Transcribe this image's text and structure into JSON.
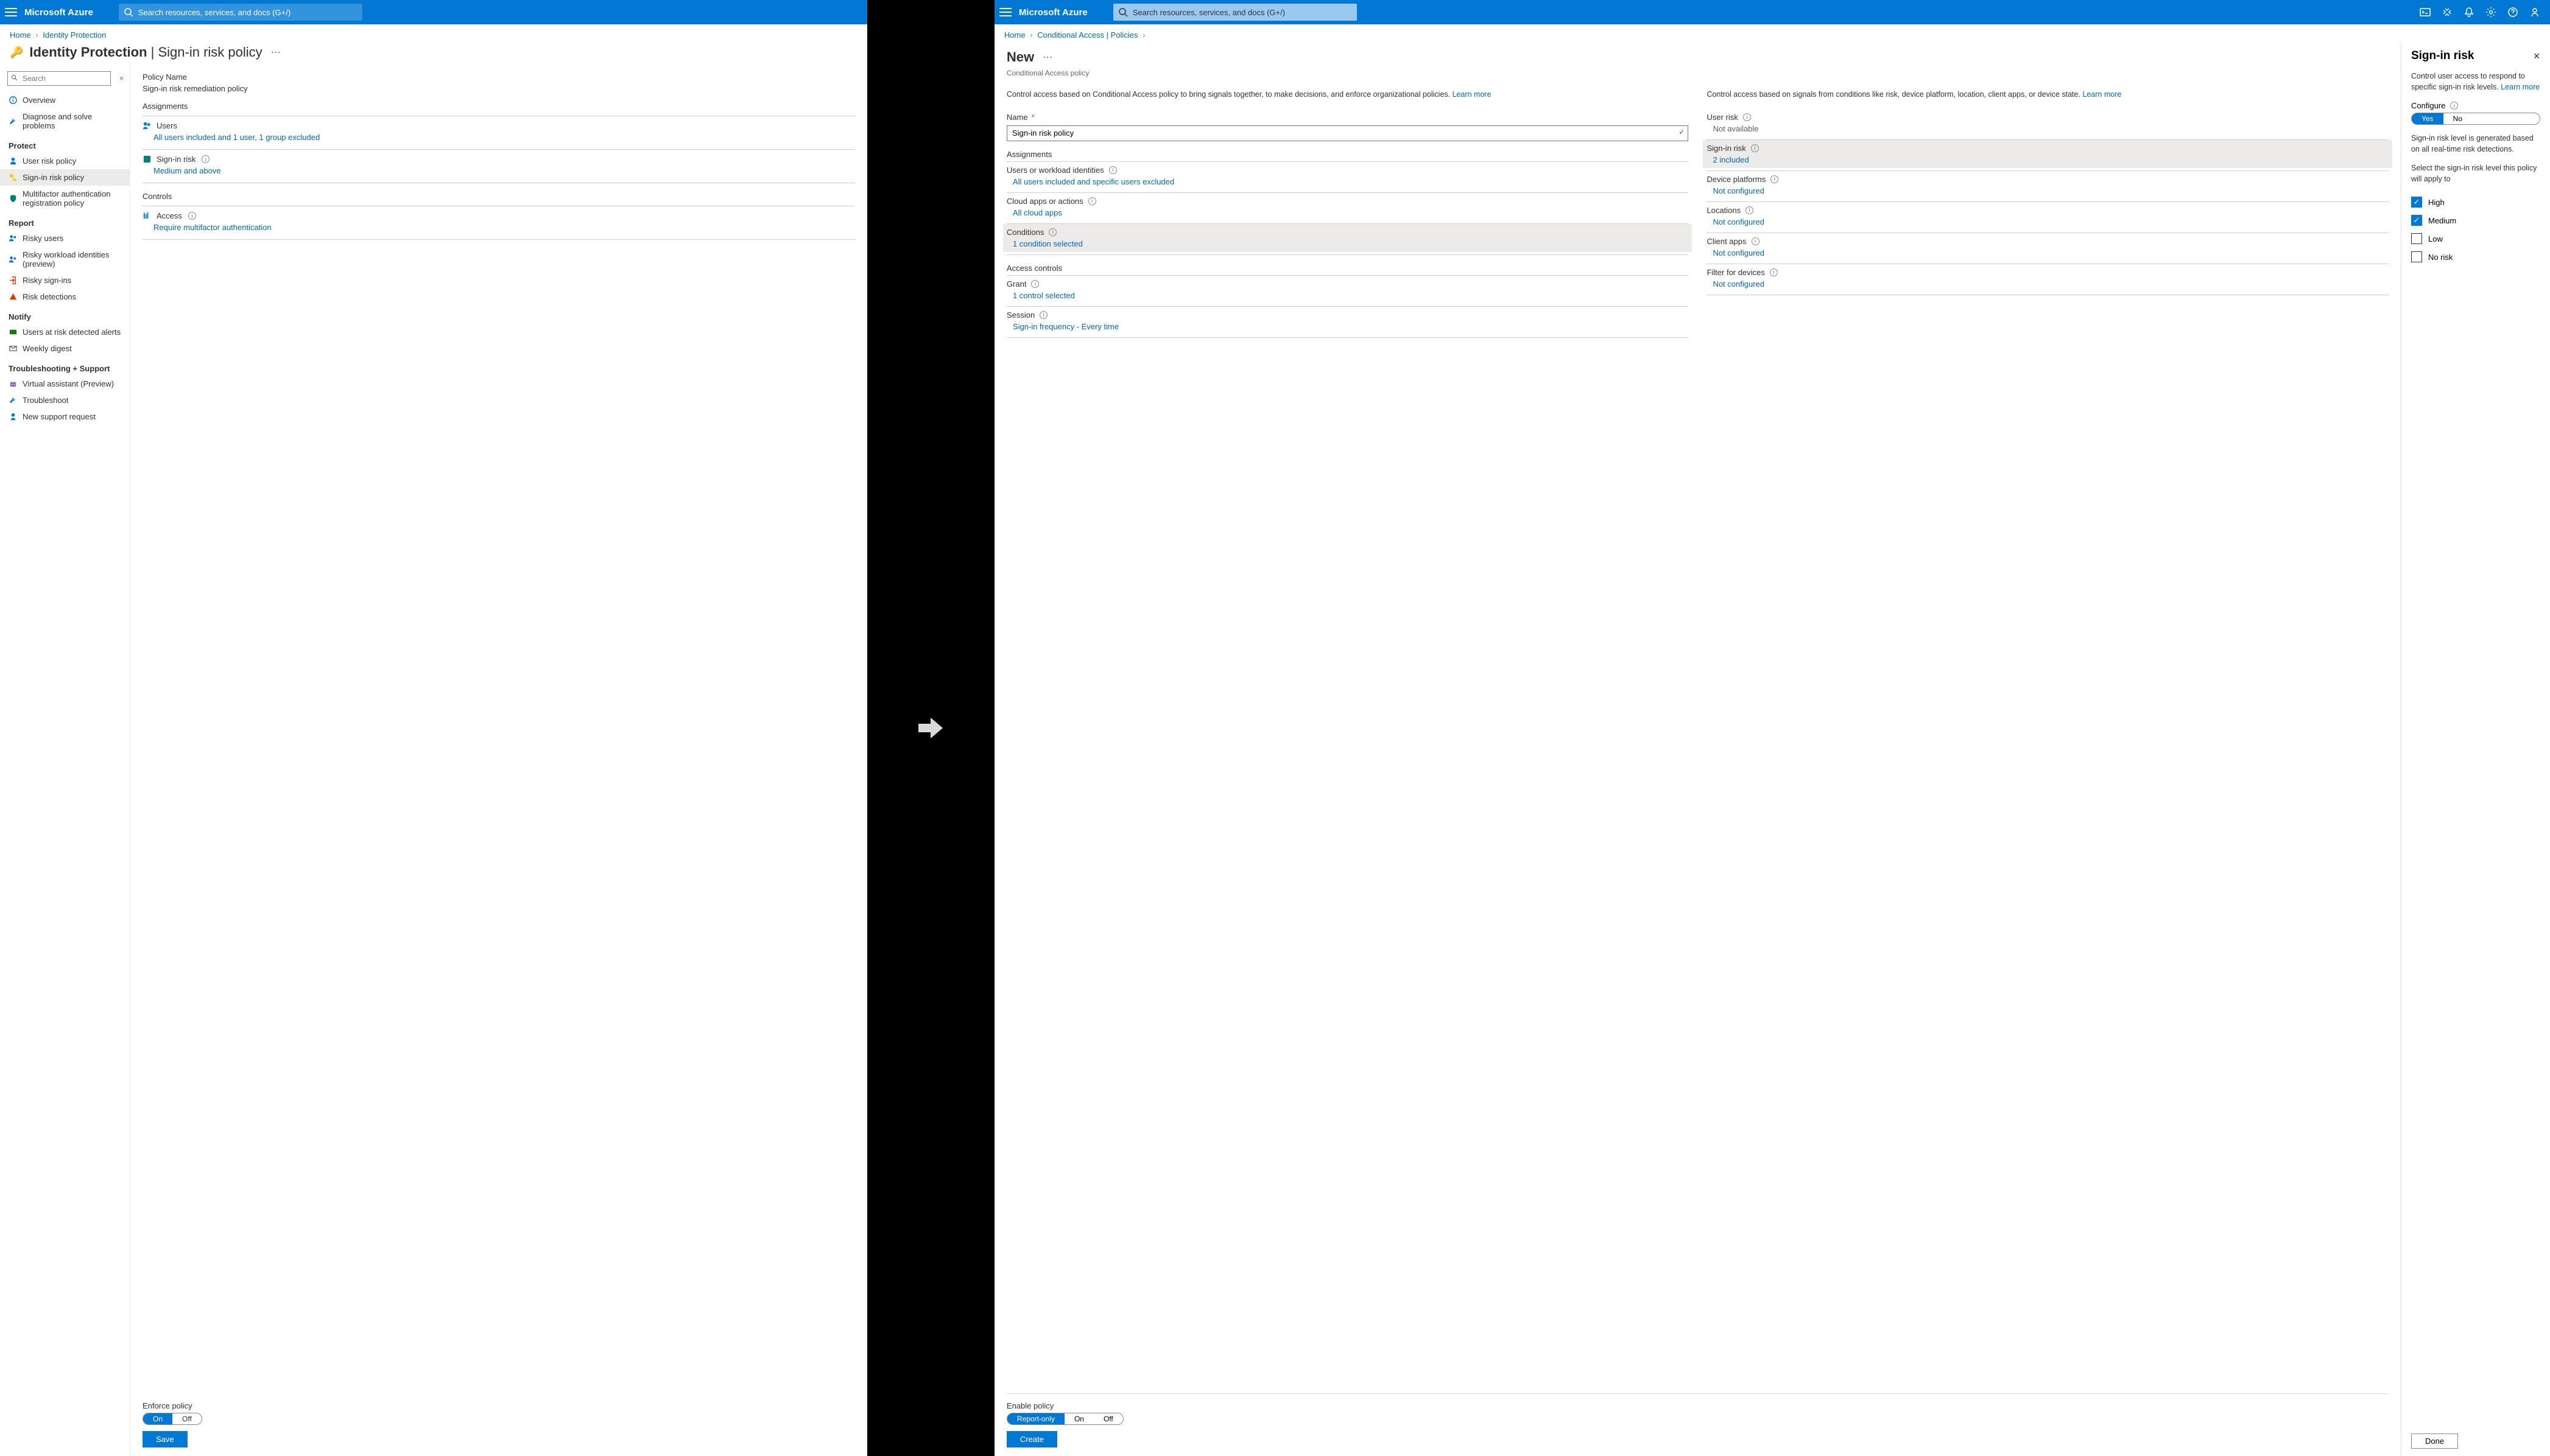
{
  "brand": "Microsoft Azure",
  "search_placeholder": "Search resources, services, and docs (G+/)",
  "left": {
    "crumbs": [
      "Home",
      "Identity Protection"
    ],
    "title_main": "Identity Protection",
    "title_sub": "Sign-in risk policy",
    "sidebar": {
      "search_placeholder": "Search",
      "items_top": [
        {
          "label": "Overview",
          "icon": "info",
          "color": "ico-blue"
        },
        {
          "label": "Diagnose and solve problems",
          "icon": "wrench",
          "color": "ico-blue"
        }
      ],
      "groups": [
        {
          "label": "Protect",
          "items": [
            {
              "label": "User risk policy",
              "icon": "user",
              "color": "ico-blue"
            },
            {
              "label": "Sign-in risk policy",
              "icon": "key",
              "color": "ico-yellow",
              "active": true
            },
            {
              "label": "Multifactor authentication registration policy",
              "icon": "shield",
              "color": "ico-teal"
            }
          ]
        },
        {
          "label": "Report",
          "items": [
            {
              "label": "Risky users",
              "icon": "users",
              "color": "ico-blue"
            },
            {
              "label": "Risky workload identities (preview)",
              "icon": "users",
              "color": "ico-blue"
            },
            {
              "label": "Risky sign-ins",
              "icon": "signin",
              "color": "ico-orange"
            },
            {
              "label": "Risk detections",
              "icon": "alert",
              "color": "ico-orange"
            }
          ]
        },
        {
          "label": "Notify",
          "items": [
            {
              "label": "Users at risk detected alerts",
              "icon": "card",
              "color": "ico-green"
            },
            {
              "label": "Weekly digest",
              "icon": "mail",
              "color": "ico-gray"
            }
          ]
        },
        {
          "label": "Troubleshooting + Support",
          "items": [
            {
              "label": "Virtual assistant (Preview)",
              "icon": "bot",
              "color": "ico-purple"
            },
            {
              "label": "Troubleshoot",
              "icon": "wrench",
              "color": "ico-blue"
            },
            {
              "label": "New support request",
              "icon": "support",
              "color": "ico-blue"
            }
          ]
        }
      ]
    },
    "content": {
      "policy_name_label": "Policy Name",
      "policy_name_value": "Sign-in risk remediation policy",
      "assignments_label": "Assignments",
      "users_label": "Users",
      "users_value": "All users included and 1 user, 1 group excluded",
      "signin_risk_label": "Sign-in risk",
      "signin_risk_value": "Medium and above",
      "controls_label": "Controls",
      "access_label": "Access",
      "access_value": "Require multifactor authentication",
      "enforce_label": "Enforce policy",
      "toggle_on": "On",
      "toggle_off": "Off",
      "save": "Save"
    }
  },
  "right": {
    "crumbs": [
      "Home",
      "Conditional Access | Policies"
    ],
    "title": "New",
    "subtitle": "Conditional Access policy",
    "intro_left": "Control access based on Conditional Access policy to bring signals together, to make decisions, and enforce organizational policies.",
    "intro_right": "Control access based on signals from conditions like risk, device platform, location, client apps, or device state.",
    "learn_more": "Learn more",
    "name_label": "Name",
    "name_value": "Sign-in risk policy",
    "sections_left": {
      "assignments": "Assignments",
      "users_label": "Users or workload identities",
      "users_value": "All users included and specific users excluded",
      "apps_label": "Cloud apps or actions",
      "apps_value": "All cloud apps",
      "conditions_label": "Conditions",
      "conditions_value": "1 condition selected",
      "access_controls": "Access controls",
      "grant_label": "Grant",
      "grant_value": "1 control selected",
      "session_label": "Session",
      "session_value": "Sign-in frequency - Every time"
    },
    "sections_right": {
      "user_risk_label": "User risk",
      "user_risk_value": "Not available",
      "signin_risk_label": "Sign-in risk",
      "signin_risk_value": "2 included",
      "device_label": "Device platforms",
      "device_value": "Not configured",
      "locations_label": "Locations",
      "locations_value": "Not configured",
      "client_label": "Client apps",
      "client_value": "Not configured",
      "filter_label": "Filter for devices",
      "filter_value": "Not configured"
    },
    "footer": {
      "enable_label": "Enable policy",
      "opt1": "Report-only",
      "opt2": "On",
      "opt3": "Off",
      "create": "Create"
    },
    "flyout": {
      "title": "Sign-in risk",
      "intro": "Control user access to respond to specific sign-in risk levels.",
      "learn_more": "Learn more",
      "configure_label": "Configure",
      "yes": "Yes",
      "no": "No",
      "note": "Sign-in risk level is generated based on all real-time risk detections.",
      "select_label": "Select the sign-in risk level this policy will apply to",
      "options": [
        {
          "label": "High",
          "checked": true
        },
        {
          "label": "Medium",
          "checked": true
        },
        {
          "label": "Low",
          "checked": false
        },
        {
          "label": "No risk",
          "checked": false
        }
      ],
      "done": "Done"
    }
  }
}
